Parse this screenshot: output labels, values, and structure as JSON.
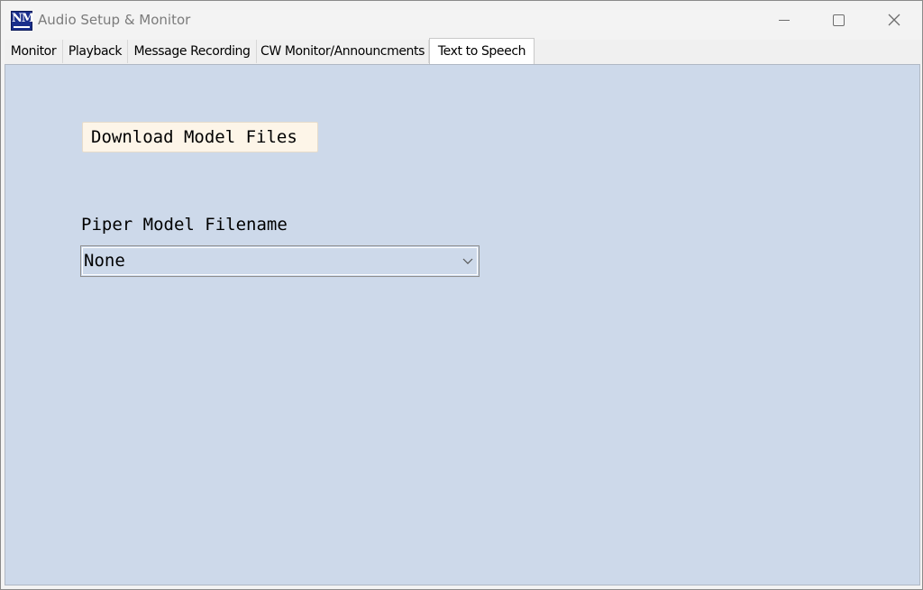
{
  "window": {
    "title": "Audio Setup & Monitor",
    "icon_name": "app-logo-icon",
    "icon_letters": "NM"
  },
  "tabs": [
    {
      "label": "Monitor",
      "active": false
    },
    {
      "label": "Playback",
      "active": false
    },
    {
      "label": "Message Recording",
      "active": false
    },
    {
      "label": "CW Monitor/Announcments",
      "active": false
    },
    {
      "label": "Text to Speech",
      "active": true
    }
  ],
  "tts": {
    "download_button_label": "Download Model Files",
    "model_field_label": "Piper Model Filename",
    "model_selected": "None"
  },
  "colors": {
    "panel_background": "#cdd9ea",
    "button_background": "#fdf5e8",
    "title_text": "#7b7b7b"
  }
}
